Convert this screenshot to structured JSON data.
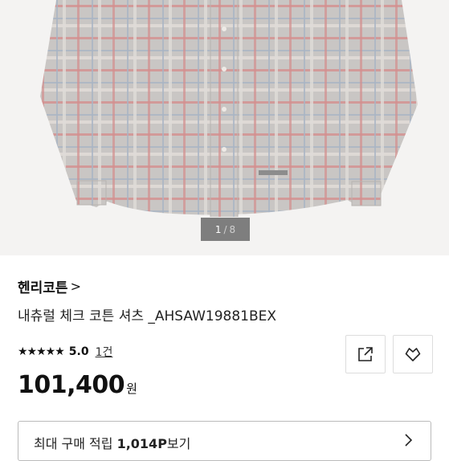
{
  "gallery": {
    "current": "1",
    "separator": "/",
    "total": "8"
  },
  "product": {
    "brand": "헨리코튼",
    "brand_chevron": ">",
    "title": "내츄럴 체크 코튼 셔츠 _AHSAW19881BEX",
    "stars": "★★★★★",
    "rating": "5.0",
    "review_count": "1건",
    "price": "101,400",
    "currency": "원"
  },
  "points": {
    "prefix": "최대 구매 적립 ",
    "amount": "1,014P",
    "suffix": "보기"
  },
  "icons": [
    "share-icon",
    "heart-icon",
    "chevron-right-icon"
  ]
}
